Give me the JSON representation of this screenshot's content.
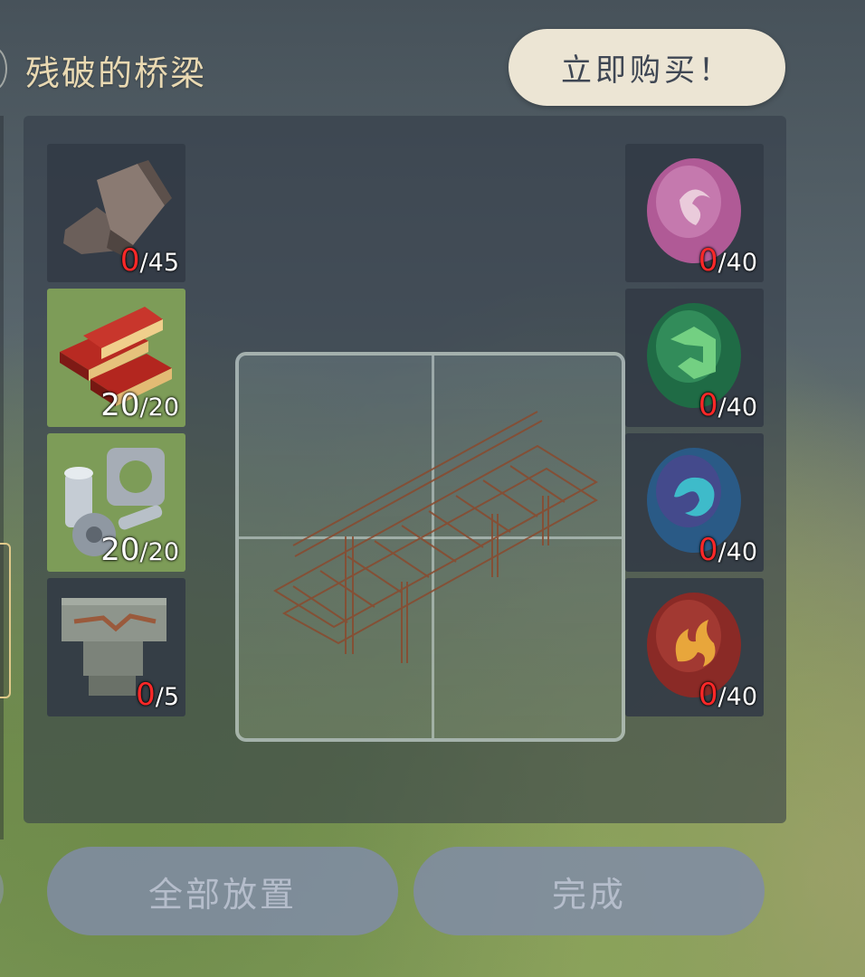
{
  "header": {
    "title": "残破的桥梁",
    "buy_button_label": "立即购买！"
  },
  "materials_left": [
    {
      "icon": "stone-blocks-icon",
      "have": "0",
      "need": "/45"
    },
    {
      "icon": "red-wood-planks-icon",
      "have": "20",
      "need": "/20"
    },
    {
      "icon": "metal-parts-icon",
      "have": "20",
      "need": "/20"
    },
    {
      "icon": "carved-stone-icon",
      "have": "0",
      "need": "/5"
    }
  ],
  "materials_right": [
    {
      "icon": "anemo-crystal-icon",
      "have": "0",
      "need": "/40"
    },
    {
      "icon": "dendro-crystal-icon",
      "have": "0",
      "need": "/40"
    },
    {
      "icon": "hydro-crystal-icon",
      "have": "0",
      "need": "/40"
    },
    {
      "icon": "pyro-crystal-icon",
      "have": "0",
      "need": "/40"
    }
  ],
  "actions": {
    "place_all_label": "全部放置",
    "complete_label": "完成"
  },
  "colors": {
    "zero_count": "#ff2828",
    "filled_slot": "#7d9c58",
    "title_text": "#e9d9b2"
  }
}
